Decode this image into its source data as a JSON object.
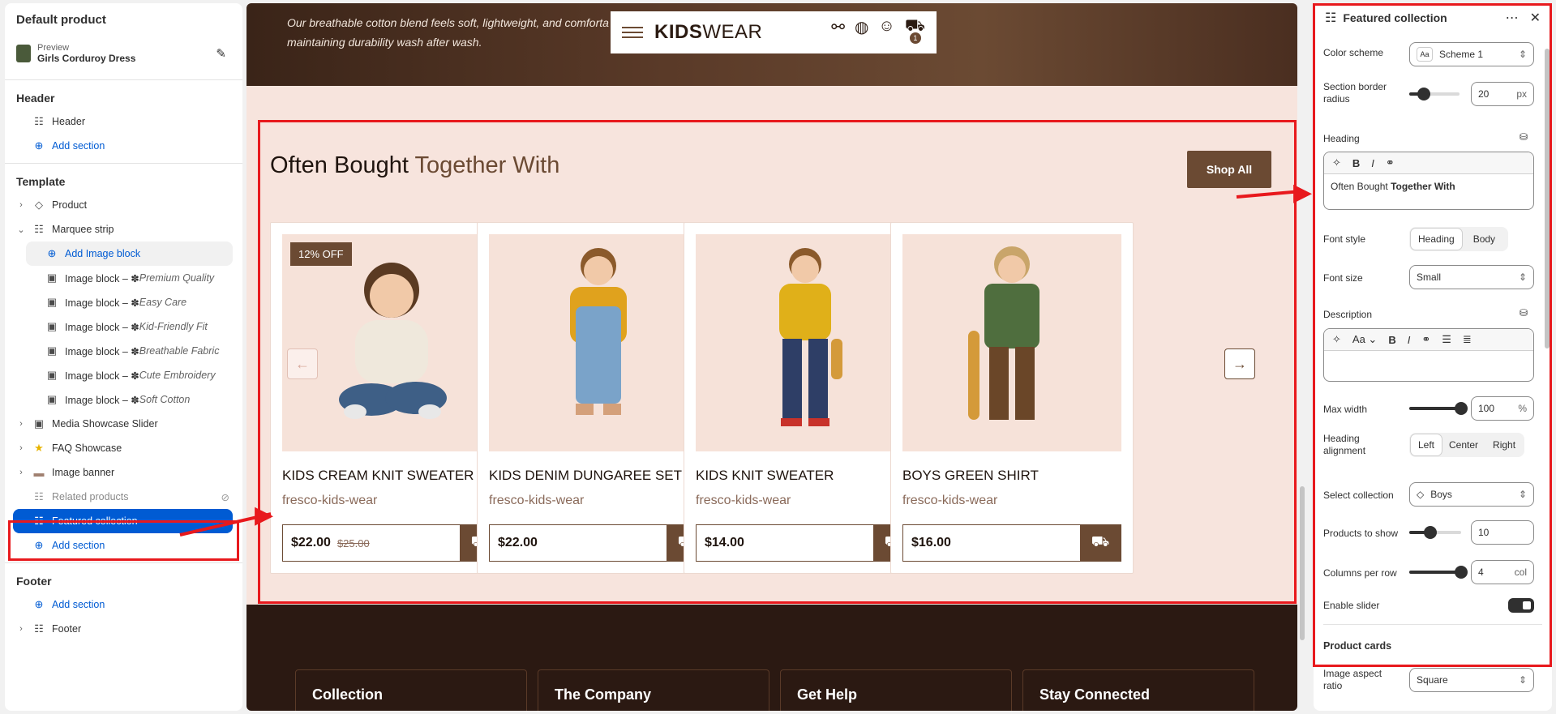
{
  "sidebar": {
    "title": "Default product",
    "preview_label": "Preview",
    "preview_product": "Girls Corduroy Dress",
    "header_group": "Header",
    "header_item": "Header",
    "add_section": "Add section",
    "template_group": "Template",
    "items": [
      {
        "label": "Product"
      },
      {
        "label": "Marquee strip"
      },
      {
        "label": "Add Image block"
      }
    ],
    "image_blocks": [
      {
        "label": "Image block – ✽ ",
        "suffix": "Premium Quality"
      },
      {
        "label": "Image block – ✽ ",
        "suffix": "Easy Care"
      },
      {
        "label": "Image block – ✽ ",
        "suffix": "Kid-Friendly Fit"
      },
      {
        "label": "Image block – ✽ ",
        "suffix": "Breathable Fabric"
      },
      {
        "label": "Image block – ✽ ",
        "suffix": "Cute Embroidery"
      },
      {
        "label": "Image block – ✽ ",
        "suffix": "Soft Cotton"
      }
    ],
    "more_items": [
      {
        "label": "Media Showcase Slider"
      },
      {
        "label": "FAQ Showcase"
      },
      {
        "label": "Image banner"
      },
      {
        "label": "Related products"
      },
      {
        "label": "Featured collection"
      }
    ],
    "footer_group": "Footer",
    "footer_item": "Footer"
  },
  "storefront": {
    "hero_text_1": "Our breathable cotton blend feels soft, lightweight, and comforta",
    "hero_text_2": "maintaining durability wash after wash.",
    "logo_bold": "KIDS",
    "logo_light": "WEAR",
    "cart_count": "1",
    "heading_plain": "Often Bought ",
    "heading_accent": "Together With",
    "shop_all": "Shop All",
    "products": [
      {
        "name": "KIDS CREAM KNIT SWEATER",
        "vendor": "fresco-kids-wear",
        "price": "$22.00",
        "compare": "$25.00",
        "badge": "12% OFF"
      },
      {
        "name": "KIDS DENIM DUNGAREE SET",
        "vendor": "fresco-kids-wear",
        "price": "$22.00"
      },
      {
        "name": "KIDS KNIT SWEATER",
        "vendor": "fresco-kids-wear",
        "price": "$14.00"
      },
      {
        "name": "BOYS GREEN SHIRT",
        "vendor": "fresco-kids-wear",
        "price": "$16.00"
      }
    ],
    "footer_cols": [
      "Collection",
      "The Company",
      "Get Help",
      "Stay Connected"
    ]
  },
  "panel": {
    "title": "Featured collection",
    "color_scheme_label": "Color scheme",
    "color_scheme_value": "Scheme 1",
    "border_radius_label": "Section border radius",
    "border_radius_value": "20",
    "border_radius_unit": "px",
    "heading_label": "Heading",
    "heading_value_plain": "Often Bought ",
    "heading_value_bold": "Together With",
    "font_style_label": "Font style",
    "font_style_opt1": "Heading",
    "font_style_opt2": "Body",
    "font_size_label": "Font size",
    "font_size_value": "Small",
    "description_label": "Description",
    "max_width_label": "Max width",
    "max_width_value": "100",
    "max_width_unit": "%",
    "heading_alignment_label": "Heading alignment",
    "align_left": "Left",
    "align_center": "Center",
    "align_right": "Right",
    "select_collection_label": "Select collection",
    "select_collection_value": "Boys",
    "products_to_show_label": "Products to show",
    "products_to_show_value": "10",
    "columns_per_row_label": "Columns per row",
    "columns_per_row_value": "4",
    "columns_unit": "col",
    "enable_slider_label": "Enable slider",
    "enable_slider_on": true,
    "product_cards_label": "Product cards",
    "image_aspect_label": "Image aspect ratio",
    "image_aspect_value": "Square",
    "controls": {
      "border_radius_level": 0.3,
      "max_width_level": 1.0,
      "products_level": 0.38,
      "columns_level": 1.0
    }
  },
  "colors": {
    "accent_blue": "#005bd3",
    "brand_brown": "#6b4a33",
    "annotation_red": "#e8191d"
  }
}
